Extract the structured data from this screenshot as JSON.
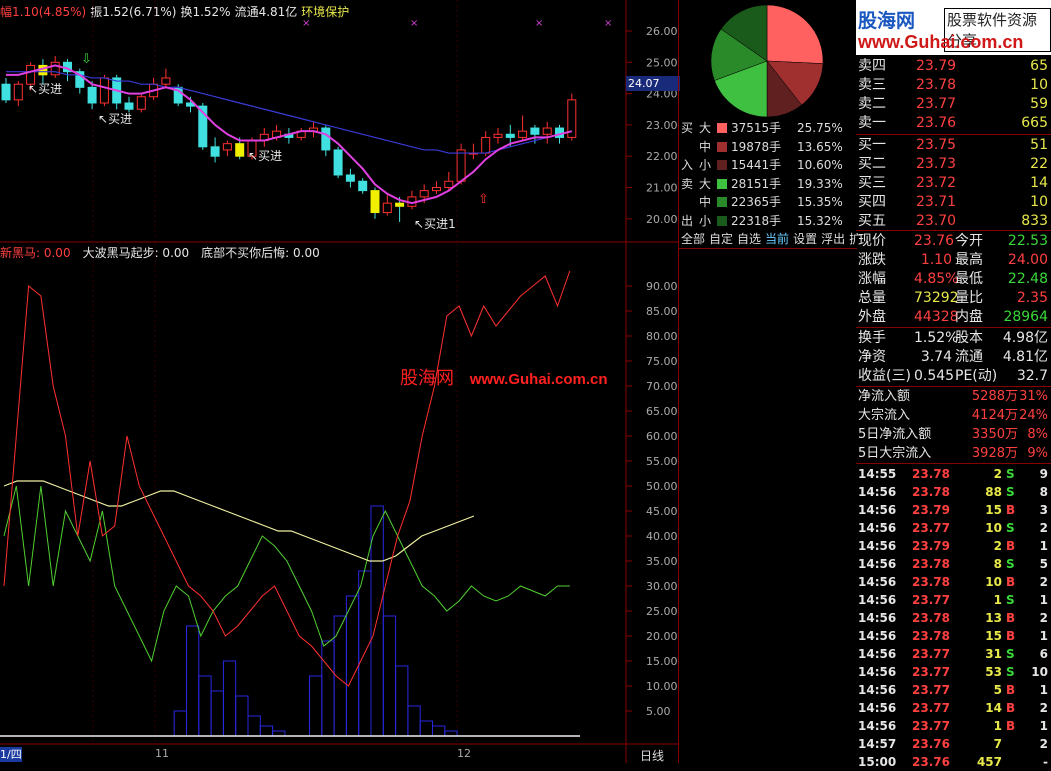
{
  "header": {
    "items": [
      {
        "label": "幅",
        "value": "1.10(4.85%)",
        "color": "#ff4040"
      },
      {
        "label": "振",
        "value": "1.52(6.71%)",
        "color": "#e6e6e6"
      },
      {
        "label": "换",
        "value": "1.52%",
        "color": "#e6e6e6"
      },
      {
        "label": "流通",
        "value": "4.81亿",
        "color": "#e6e6e6"
      },
      {
        "label": "环境保护",
        "value": "",
        "color": "#e8e84a"
      }
    ]
  },
  "price_axis": [
    "26.00",
    "25.00",
    "24.00",
    "23.00",
    "22.00",
    "21.00",
    "20.00"
  ],
  "price_tag": "24.07",
  "buy_signals": [
    "买进",
    "买进",
    "买进",
    "买进1"
  ],
  "indicator": {
    "legend": [
      {
        "label": "新黑马: 0.00",
        "color": "#ff4040"
      },
      {
        "label": "大波黑马起步: 0.00",
        "color": "#e6e6e6"
      },
      {
        "label": "底部不买你后悔: 0.00",
        "color": "#e6e6e6"
      }
    ],
    "axis": [
      "90.00",
      "85.00",
      "80.00",
      "75.00",
      "70.00",
      "65.00",
      "60.00",
      "55.00",
      "50.00",
      "45.00",
      "40.00",
      "35.00",
      "30.00",
      "25.00",
      "20.00",
      "15.00",
      "10.00",
      "5.00"
    ]
  },
  "watermark": {
    "brand": "股海网",
    "url": "www.Guhai.com.cn"
  },
  "banner": {
    "brand": "股海网",
    "slogan": "股票软件资源分享",
    "url": "www.Guhai.com.cn"
  },
  "date_axis": [
    "1/四",
    "11",
    "12"
  ],
  "period_label": "日线",
  "flows": [
    {
      "side": "买",
      "size": "大",
      "amount": "37515手",
      "pct": "25.75%",
      "color": "#ff6060"
    },
    {
      "side": "",
      "size": "中",
      "amount": "19878手",
      "pct": "13.65%",
      "color": "#a03030"
    },
    {
      "side": "入",
      "size": "小",
      "amount": "15441手",
      "pct": "10.60%",
      "color": "#602020"
    },
    {
      "side": "卖",
      "size": "大",
      "amount": "28151手",
      "pct": "19.33%",
      "color": "#40c040"
    },
    {
      "side": "",
      "size": "中",
      "amount": "22365手",
      "pct": "15.35%",
      "color": "#2a8a2a"
    },
    {
      "side": "出",
      "size": "小",
      "amount": "22318手",
      "pct": "15.32%",
      "color": "#1a5a1a"
    }
  ],
  "pie_values": [
    25.75,
    13.65,
    10.6,
    19.33,
    15.35,
    15.32
  ],
  "tabs": [
    "全部",
    "自定",
    "自选",
    "当前",
    "设置",
    "浮出",
    "扩"
  ],
  "active_tab": "当前",
  "sells": [
    {
      "label": "卖四",
      "price": "23.79",
      "vol": "65"
    },
    {
      "label": "卖三",
      "price": "23.78",
      "vol": "10"
    },
    {
      "label": "卖二",
      "price": "23.77",
      "vol": "59"
    },
    {
      "label": "卖一",
      "price": "23.76",
      "vol": "665"
    }
  ],
  "buys": [
    {
      "label": "买一",
      "price": "23.75",
      "vol": "51"
    },
    {
      "label": "买二",
      "price": "23.73",
      "vol": "22"
    },
    {
      "label": "买三",
      "price": "23.72",
      "vol": "14"
    },
    {
      "label": "买四",
      "price": "23.71",
      "vol": "10"
    },
    {
      "label": "买五",
      "price": "23.70",
      "vol": "833"
    }
  ],
  "quote": [
    {
      "l1": "现价",
      "v1": "23.76",
      "c1": "#ff4040",
      "l2": "今开",
      "v2": "22.53",
      "c2": "#39d839"
    },
    {
      "l1": "涨跌",
      "v1": "1.10",
      "c1": "#ff4040",
      "l2": "最高",
      "v2": "24.00",
      "c2": "#ff4040"
    },
    {
      "l1": "涨幅",
      "v1": "4.85%",
      "c1": "#ff4040",
      "l2": "最低",
      "v2": "22.48",
      "c2": "#39d839"
    },
    {
      "l1": "总量",
      "v1": "73292",
      "c1": "#e8e84a",
      "l2": "量比",
      "v2": "2.35",
      "c2": "#ff4040"
    },
    {
      "l1": "外盘",
      "v1": "44328",
      "c1": "#ff4040",
      "l2": "内盘",
      "v2": "28964",
      "c2": "#39d839"
    }
  ],
  "stats": [
    {
      "l1": "换手",
      "v1": "1.52%",
      "l2": "股本",
      "v2": "4.98亿"
    },
    {
      "l1": "净资",
      "v1": "3.74",
      "l2": "流通",
      "v2": "4.81亿"
    },
    {
      "l1": "收益(三)",
      "v1": "0.545",
      "l2": "PE(动)",
      "v2": "32.7"
    }
  ],
  "capital": [
    {
      "label": "净流入额",
      "value": "5288万",
      "pct": "31%"
    },
    {
      "label": "大宗流入",
      "value": "4124万",
      "pct": "24%"
    },
    {
      "label": "5日净流入额",
      "value": "3350万",
      "pct": "8%"
    },
    {
      "label": "5日大宗流入",
      "value": "3928万",
      "pct": "9%"
    }
  ],
  "ticks": [
    {
      "time": "14:55",
      "price": "23.78",
      "vol": "2",
      "bs": "S",
      "n": "9"
    },
    {
      "time": "14:56",
      "price": "23.78",
      "vol": "88",
      "bs": "S",
      "n": "8"
    },
    {
      "time": "14:56",
      "price": "23.79",
      "vol": "15",
      "bs": "B",
      "n": "3"
    },
    {
      "time": "14:56",
      "price": "23.77",
      "vol": "10",
      "bs": "S",
      "n": "2"
    },
    {
      "time": "14:56",
      "price": "23.79",
      "vol": "2",
      "bs": "B",
      "n": "1"
    },
    {
      "time": "14:56",
      "price": "23.78",
      "vol": "8",
      "bs": "S",
      "n": "5"
    },
    {
      "time": "14:56",
      "price": "23.78",
      "vol": "10",
      "bs": "B",
      "n": "2"
    },
    {
      "time": "14:56",
      "price": "23.77",
      "vol": "1",
      "bs": "S",
      "n": "1"
    },
    {
      "time": "14:56",
      "price": "23.78",
      "vol": "13",
      "bs": "B",
      "n": "2"
    },
    {
      "time": "14:56",
      "price": "23.78",
      "vol": "15",
      "bs": "B",
      "n": "1"
    },
    {
      "time": "14:56",
      "price": "23.77",
      "vol": "31",
      "bs": "S",
      "n": "6"
    },
    {
      "time": "14:56",
      "price": "23.77",
      "vol": "53",
      "bs": "S",
      "n": "10"
    },
    {
      "time": "14:56",
      "price": "23.77",
      "vol": "5",
      "bs": "B",
      "n": "1"
    },
    {
      "time": "14:56",
      "price": "23.77",
      "vol": "14",
      "bs": "B",
      "n": "2"
    },
    {
      "time": "14:56",
      "price": "23.77",
      "vol": "1",
      "bs": "B",
      "n": "1"
    },
    {
      "time": "14:57",
      "price": "23.76",
      "vol": "7",
      "bs": "",
      "n": "2"
    },
    {
      "time": "15:00",
      "price": "23.76",
      "vol": "457",
      "bs": "",
      "n": "-"
    }
  ],
  "candles": [
    {
      "o": 24.3,
      "c": 23.8,
      "h": 24.5,
      "l": 23.7
    },
    {
      "o": 23.8,
      "c": 24.3,
      "h": 24.4,
      "l": 23.6
    },
    {
      "o": 24.3,
      "c": 24.9,
      "h": 25.0,
      "l": 24.1
    },
    {
      "o": 24.9,
      "c": 24.6,
      "h": 25.1,
      "l": 24.3
    },
    {
      "o": 24.6,
      "c": 25.0,
      "h": 25.2,
      "l": 24.5
    },
    {
      "o": 25.0,
      "c": 24.7,
      "h": 25.1,
      "l": 24.4
    },
    {
      "o": 24.7,
      "c": 24.2,
      "h": 24.8,
      "l": 24.0
    },
    {
      "o": 24.2,
      "c": 23.7,
      "h": 24.4,
      "l": 23.5
    },
    {
      "o": 23.7,
      "c": 24.5,
      "h": 24.6,
      "l": 23.6
    },
    {
      "o": 24.5,
      "c": 23.7,
      "h": 24.6,
      "l": 23.5
    },
    {
      "o": 23.7,
      "c": 23.5,
      "h": 23.9,
      "l": 23.4
    },
    {
      "o": 23.5,
      "c": 23.9,
      "h": 24.0,
      "l": 23.4
    },
    {
      "o": 23.9,
      "c": 24.3,
      "h": 24.5,
      "l": 23.8
    },
    {
      "o": 24.3,
      "c": 24.5,
      "h": 24.8,
      "l": 24.2
    },
    {
      "o": 24.2,
      "c": 23.7,
      "h": 24.3,
      "l": 23.6
    },
    {
      "o": 23.7,
      "c": 23.6,
      "h": 23.9,
      "l": 23.4
    },
    {
      "o": 23.6,
      "c": 22.3,
      "h": 23.7,
      "l": 22.2
    },
    {
      "o": 22.3,
      "c": 22.0,
      "h": 22.6,
      "l": 21.8
    },
    {
      "o": 22.2,
      "c": 22.4,
      "h": 22.5,
      "l": 22.0
    },
    {
      "o": 22.4,
      "c": 22.0,
      "h": 22.6,
      "l": 21.9
    },
    {
      "o": 22.0,
      "c": 22.5,
      "h": 22.6,
      "l": 21.9
    },
    {
      "o": 22.5,
      "c": 22.7,
      "h": 22.9,
      "l": 22.3
    },
    {
      "o": 22.6,
      "c": 22.8,
      "h": 23.0,
      "l": 22.5
    },
    {
      "o": 22.7,
      "c": 22.6,
      "h": 22.9,
      "l": 22.4
    },
    {
      "o": 22.6,
      "c": 22.8,
      "h": 22.9,
      "l": 22.5
    },
    {
      "o": 22.8,
      "c": 22.9,
      "h": 23.1,
      "l": 22.6
    },
    {
      "o": 22.9,
      "c": 22.2,
      "h": 23.0,
      "l": 22.0
    },
    {
      "o": 22.2,
      "c": 21.4,
      "h": 22.3,
      "l": 21.3
    },
    {
      "o": 21.4,
      "c": 21.2,
      "h": 21.6,
      "l": 21.0
    },
    {
      "o": 21.2,
      "c": 20.9,
      "h": 21.3,
      "l": 20.8
    },
    {
      "o": 20.9,
      "c": 20.2,
      "h": 21.0,
      "l": 20.0
    },
    {
      "o": 20.2,
      "c": 20.5,
      "h": 20.8,
      "l": 20.1
    },
    {
      "o": 20.5,
      "c": 20.4,
      "h": 20.7,
      "l": 19.9
    },
    {
      "o": 20.4,
      "c": 20.7,
      "h": 20.9,
      "l": 20.3
    },
    {
      "o": 20.7,
      "c": 20.9,
      "h": 21.1,
      "l": 20.5
    },
    {
      "o": 20.9,
      "c": 21.0,
      "h": 21.2,
      "l": 20.8
    },
    {
      "o": 21.0,
      "c": 21.2,
      "h": 21.5,
      "l": 20.9
    },
    {
      "o": 21.2,
      "c": 22.2,
      "h": 22.4,
      "l": 21.1
    },
    {
      "o": 22.1,
      "c": 22.1,
      "h": 22.4,
      "l": 21.9
    },
    {
      "o": 22.1,
      "c": 22.6,
      "h": 22.8,
      "l": 22.0
    },
    {
      "o": 22.6,
      "c": 22.7,
      "h": 22.9,
      "l": 22.4
    },
    {
      "o": 22.7,
      "c": 22.6,
      "h": 23.0,
      "l": 22.3
    },
    {
      "o": 22.6,
      "c": 22.8,
      "h": 23.3,
      "l": 22.5
    },
    {
      "o": 22.9,
      "c": 22.7,
      "h": 23.0,
      "l": 22.4
    },
    {
      "o": 22.7,
      "c": 22.9,
      "h": 23.1,
      "l": 22.4
    },
    {
      "o": 22.9,
      "c": 22.6,
      "h": 23.0,
      "l": 22.4
    },
    {
      "o": 22.6,
      "c": 23.8,
      "h": 24.0,
      "l": 22.5
    }
  ],
  "ma_fast": [
    24.6,
    24.6,
    24.7,
    24.8,
    24.9,
    24.8,
    24.6,
    24.3,
    24.2,
    24.1,
    24.0,
    24.0,
    24.1,
    24.2,
    24.1,
    23.8,
    23.4,
    23.0,
    22.7,
    22.5,
    22.5,
    22.5,
    22.6,
    22.7,
    22.8,
    22.8,
    22.7,
    22.4,
    22.0,
    21.6,
    21.1,
    20.8,
    20.6,
    20.5,
    20.6,
    20.7,
    20.9,
    21.2,
    21.5,
    21.9,
    22.2,
    22.4,
    22.5,
    22.6,
    22.6,
    22.7,
    22.8
  ],
  "ma_slow": [
    24.7,
    24.7,
    24.7,
    24.7,
    24.7,
    24.6,
    24.6,
    24.5,
    24.5,
    24.4,
    24.4,
    24.3,
    24.3,
    24.2,
    24.2,
    24.1,
    24.0,
    23.9,
    23.8,
    23.7,
    23.6,
    23.5,
    23.4,
    23.3,
    23.2,
    23.1,
    23.0,
    22.9,
    22.8,
    22.7,
    22.6,
    22.5,
    22.4,
    22.3,
    22.2,
    22.2,
    22.1,
    22.1,
    22.1,
    22.1,
    22.2,
    22.3,
    22.4,
    22.5,
    22.6,
    22.7,
    22.8
  ],
  "ind_red": [
    30,
    60,
    90,
    88,
    70,
    60,
    40,
    55,
    40,
    42,
    60,
    50,
    45,
    40,
    35,
    30,
    28,
    25,
    20,
    22,
    25,
    28,
    30,
    25,
    20,
    18,
    15,
    12,
    10,
    15,
    20,
    30,
    40,
    47,
    60,
    70,
    84,
    86,
    80,
    86,
    82,
    85,
    88,
    90,
    92,
    86,
    93
  ],
  "ind_green": [
    40,
    50,
    30,
    50,
    30,
    45,
    40,
    35,
    45,
    30,
    25,
    20,
    15,
    25,
    30,
    28,
    20,
    25,
    28,
    30,
    35,
    40,
    38,
    35,
    30,
    25,
    18,
    20,
    25,
    30,
    40,
    45,
    40,
    35,
    30,
    28,
    25,
    27,
    30,
    28,
    27,
    28,
    30,
    29,
    28,
    30,
    30
  ],
  "ind_yellow": [
    50,
    51,
    51,
    51,
    50,
    49,
    48,
    47,
    46,
    46,
    47,
    48,
    49,
    49,
    48,
    47,
    46,
    45,
    44,
    43,
    42,
    41,
    41,
    40,
    39,
    38,
    37,
    36,
    35,
    35,
    36,
    38,
    40,
    41,
    42,
    43,
    44
  ],
  "ind_hist": [
    0,
    0,
    0,
    0,
    0,
    0,
    0,
    0,
    0,
    0,
    0,
    0,
    0,
    0,
    5,
    22,
    12,
    9,
    15,
    8,
    4,
    2,
    1,
    0,
    0,
    12,
    19,
    24,
    28,
    33,
    46,
    24,
    14,
    6,
    3,
    2,
    1,
    0,
    0,
    0,
    0,
    0,
    0,
    0,
    0,
    0,
    0
  ]
}
